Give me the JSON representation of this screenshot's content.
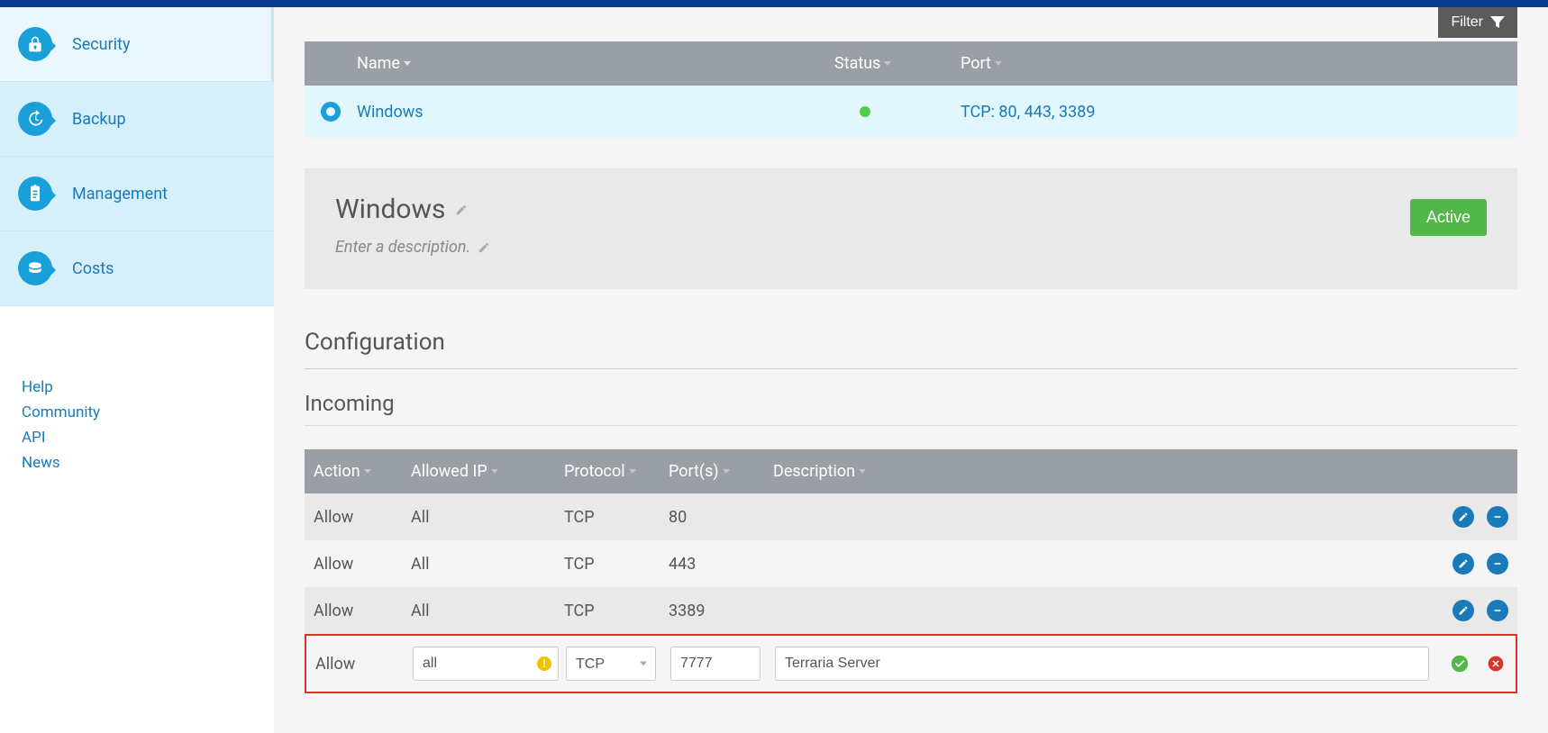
{
  "sidebar": {
    "items": [
      {
        "label": "Security",
        "icon": "lock-icon",
        "active": true
      },
      {
        "label": "Backup",
        "icon": "clock-icon",
        "active": false
      },
      {
        "label": "Management",
        "icon": "clipboard-icon",
        "active": false
      },
      {
        "label": "Costs",
        "icon": "coins-icon",
        "active": false
      }
    ],
    "secondary": [
      {
        "label": "Help"
      },
      {
        "label": "Community"
      },
      {
        "label": "API"
      },
      {
        "label": "News"
      }
    ]
  },
  "filter": {
    "label": "Filter"
  },
  "policy_table": {
    "headers": {
      "name": "Name",
      "status": "Status",
      "port": "Port"
    },
    "rows": [
      {
        "name": "Windows",
        "status": "online",
        "ports": "TCP: 80, 443, 3389"
      }
    ]
  },
  "detail": {
    "title": "Windows",
    "description_placeholder": "Enter a description.",
    "status_label": "Active"
  },
  "config": {
    "title": "Configuration",
    "incoming_title": "Incoming",
    "headers": {
      "action": "Action",
      "allowed_ip": "Allowed IP",
      "protocol": "Protocol",
      "ports": "Port(s)",
      "description": "Description"
    },
    "rules": [
      {
        "action": "Allow",
        "ip": "All",
        "proto": "TCP",
        "ports": "80",
        "desc": ""
      },
      {
        "action": "Allow",
        "ip": "All",
        "proto": "TCP",
        "ports": "443",
        "desc": ""
      },
      {
        "action": "Allow",
        "ip": "All",
        "proto": "TCP",
        "ports": "3389",
        "desc": ""
      }
    ],
    "new_rule": {
      "action": "Allow",
      "ip_value": "all",
      "proto_value": "TCP",
      "ports_value": "7777",
      "desc_value": "Terraria Server"
    }
  }
}
